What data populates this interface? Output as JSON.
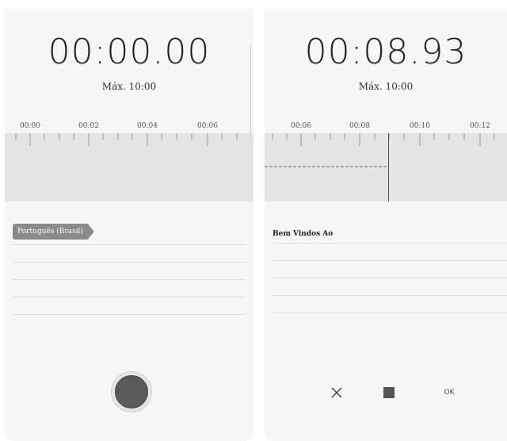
{
  "status_bar": {
    "text": ""
  },
  "left_panel": {
    "timer": "00:00.00",
    "max_label": "Máx. 10:00",
    "tick_labels": [
      "00:00",
      "00:02",
      "00:04",
      "00:06"
    ],
    "language_badge": "Português (Brasil)",
    "record_button": {
      "state": "idle",
      "icon": "record-icon"
    }
  },
  "right_panel": {
    "timer": "00:08.93",
    "max_label": "Máx. 10:00",
    "tick_labels": [
      "00:06",
      "00:08",
      "00:10",
      "00:12"
    ],
    "transcript": "Bem Vindos Ao",
    "controls": {
      "cancel_icon": "close-icon",
      "stop_icon": "stop-icon",
      "ok_label": "OK"
    }
  },
  "colors": {
    "panel_bg": "#f7f7f7",
    "ruler_bg": "#e4e4e4",
    "record": "#5a5a5a",
    "badge": "#8a8a8a"
  }
}
